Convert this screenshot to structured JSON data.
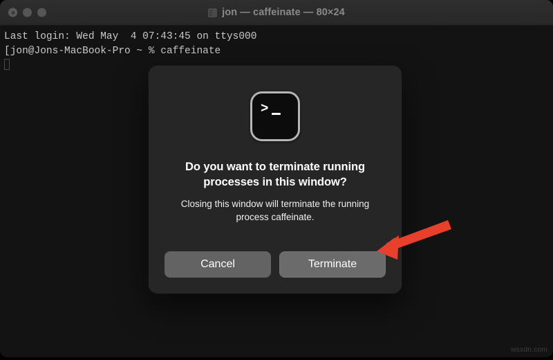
{
  "window": {
    "title": "jon — caffeinate — 80×24",
    "title_icon": "terminal-app-icon",
    "traffic_lights": [
      {
        "name": "close",
        "label": "Close"
      },
      {
        "name": "minimize",
        "label": "Minimize"
      },
      {
        "name": "zoom",
        "label": "Zoom"
      }
    ]
  },
  "terminal": {
    "lines": [
      "Last login: Wed May  4 07:43:45 on ttys000",
      "[jon@Jons-MacBook-Pro ~ % caffeinate"
    ],
    "cursor": "block-outline"
  },
  "dialog": {
    "icon": "terminal-app-icon",
    "icon_prompt": ">",
    "title": "Do you want to terminate running processes in this window?",
    "message": "Closing this window will terminate the running process caffeinate.",
    "buttons": [
      {
        "name": "cancel",
        "label": "Cancel",
        "default": false
      },
      {
        "name": "terminate",
        "label": "Terminate",
        "default": true
      }
    ]
  },
  "annotation": {
    "arrow_color": "#E8402A",
    "points_to": "terminate-button"
  },
  "watermark": {
    "text": "wsxdn.com"
  },
  "colors": {
    "terminal_background": "#131313",
    "titlebar_background": "#2b2b2b",
    "dialog_background": "#262626",
    "button_background": "#636363",
    "default_button_background": "#6b6b6b",
    "text_primary": "#ffffff",
    "terminal_text": "#c9c9c9",
    "title_text": "#8a8a8a"
  }
}
